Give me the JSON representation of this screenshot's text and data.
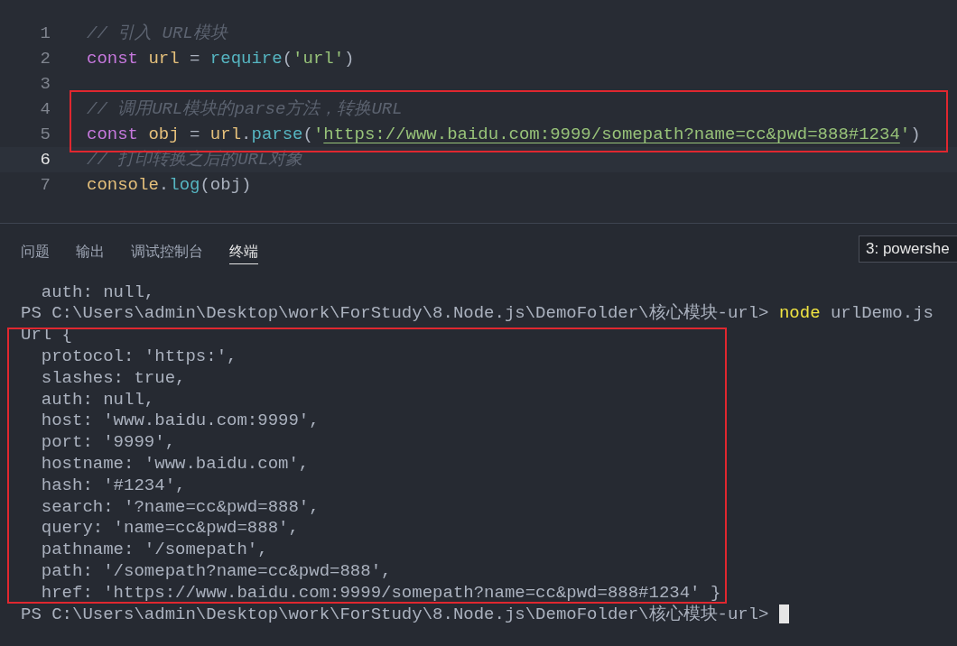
{
  "editor": {
    "lines": [
      {
        "number": "1",
        "current": false,
        "tokens": [
          {
            "kind": "comment",
            "text": "// 引入 URL模块"
          }
        ]
      },
      {
        "number": "2",
        "current": false,
        "tokens": [
          {
            "kind": "keyword",
            "text": "const "
          },
          {
            "kind": "variable",
            "text": "url"
          },
          {
            "kind": "plain",
            "text": " = "
          },
          {
            "kind": "function",
            "text": "require"
          },
          {
            "kind": "plain",
            "text": "("
          },
          {
            "kind": "string",
            "text": "'url'"
          },
          {
            "kind": "plain",
            "text": ")"
          }
        ]
      },
      {
        "number": "3",
        "current": false
      },
      {
        "number": "4",
        "current": false,
        "tokens": [
          {
            "kind": "comment",
            "text": "// 调用URL模块的parse方法，转换URL"
          }
        ]
      },
      {
        "number": "5",
        "current": false,
        "tokens": [
          {
            "kind": "keyword",
            "text": "const "
          },
          {
            "kind": "variable",
            "text": "obj"
          },
          {
            "kind": "plain",
            "text": " = "
          },
          {
            "kind": "variable",
            "text": "url"
          },
          {
            "kind": "plain",
            "text": "."
          },
          {
            "kind": "function",
            "text": "parse"
          },
          {
            "kind": "plain",
            "text": "("
          },
          {
            "kind": "string",
            "text": "'"
          },
          {
            "kind": "link",
            "text": "https://www.baidu.com:9999/somepath?name=cc&pwd=888#1234"
          },
          {
            "kind": "string",
            "text": "'"
          },
          {
            "kind": "plain",
            "text": ")"
          }
        ]
      },
      {
        "number": "6",
        "current": true,
        "tokens": [
          {
            "kind": "comment",
            "text": "// 打印转换之后的URL对象"
          }
        ]
      },
      {
        "number": "7",
        "current": false,
        "tokens": [
          {
            "kind": "object",
            "text": "console"
          },
          {
            "kind": "plain",
            "text": "."
          },
          {
            "kind": "function",
            "text": "log"
          },
          {
            "kind": "plain",
            "text": "(obj)"
          }
        ]
      }
    ]
  },
  "panel": {
    "tabs": [
      {
        "label": "问题",
        "selected": false
      },
      {
        "label": "输出",
        "selected": false
      },
      {
        "label": "调试控制台",
        "selected": false
      },
      {
        "label": "终端",
        "selected": true
      }
    ],
    "terminal_selector": "3: powershe"
  },
  "terminal": {
    "lines": [
      {
        "tokens": [
          {
            "kind": "plain",
            "text": "  auth: null,"
          }
        ]
      },
      {
        "tokens": [
          {
            "kind": "plain",
            "text": "PS C:\\Users\\admin\\Desktop\\work\\ForStudy\\8.Node.js\\DemoFolder\\核心模块-url> "
          },
          {
            "kind": "command",
            "text": "node"
          },
          {
            "kind": "plain",
            "text": " urlDemo.js"
          }
        ]
      },
      {
        "tokens": [
          {
            "kind": "plain",
            "text": "Url {"
          }
        ]
      },
      {
        "tokens": [
          {
            "kind": "plain",
            "text": "  protocol: 'https:',"
          }
        ]
      },
      {
        "tokens": [
          {
            "kind": "plain",
            "text": "  slashes: true,"
          }
        ]
      },
      {
        "tokens": [
          {
            "kind": "plain",
            "text": "  auth: null,"
          }
        ]
      },
      {
        "tokens": [
          {
            "kind": "plain",
            "text": "  host: 'www.baidu.com:9999',"
          }
        ]
      },
      {
        "tokens": [
          {
            "kind": "plain",
            "text": "  port: '9999',"
          }
        ]
      },
      {
        "tokens": [
          {
            "kind": "plain",
            "text": "  hostname: 'www.baidu.com',"
          }
        ]
      },
      {
        "tokens": [
          {
            "kind": "plain",
            "text": "  hash: '#1234',"
          }
        ]
      },
      {
        "tokens": [
          {
            "kind": "plain",
            "text": "  search: '?name=cc&pwd=888',"
          }
        ]
      },
      {
        "tokens": [
          {
            "kind": "plain",
            "text": "  query: 'name=cc&pwd=888',"
          }
        ]
      },
      {
        "tokens": [
          {
            "kind": "plain",
            "text": "  pathname: '/somepath',"
          }
        ]
      },
      {
        "tokens": [
          {
            "kind": "plain",
            "text": "  path: '/somepath?name=cc&pwd=888',"
          }
        ]
      },
      {
        "tokens": [
          {
            "kind": "plain",
            "text": "  href: 'https://www.baidu.com:9999/somepath?name=cc&pwd=888#1234' }"
          }
        ]
      },
      {
        "tokens": [
          {
            "kind": "plain",
            "text": "PS C:\\Users\\admin\\Desktop\\work\\ForStudy\\8.Node.js\\DemoFolder\\核心模块-url> "
          }
        ],
        "cursor": true
      }
    ]
  }
}
